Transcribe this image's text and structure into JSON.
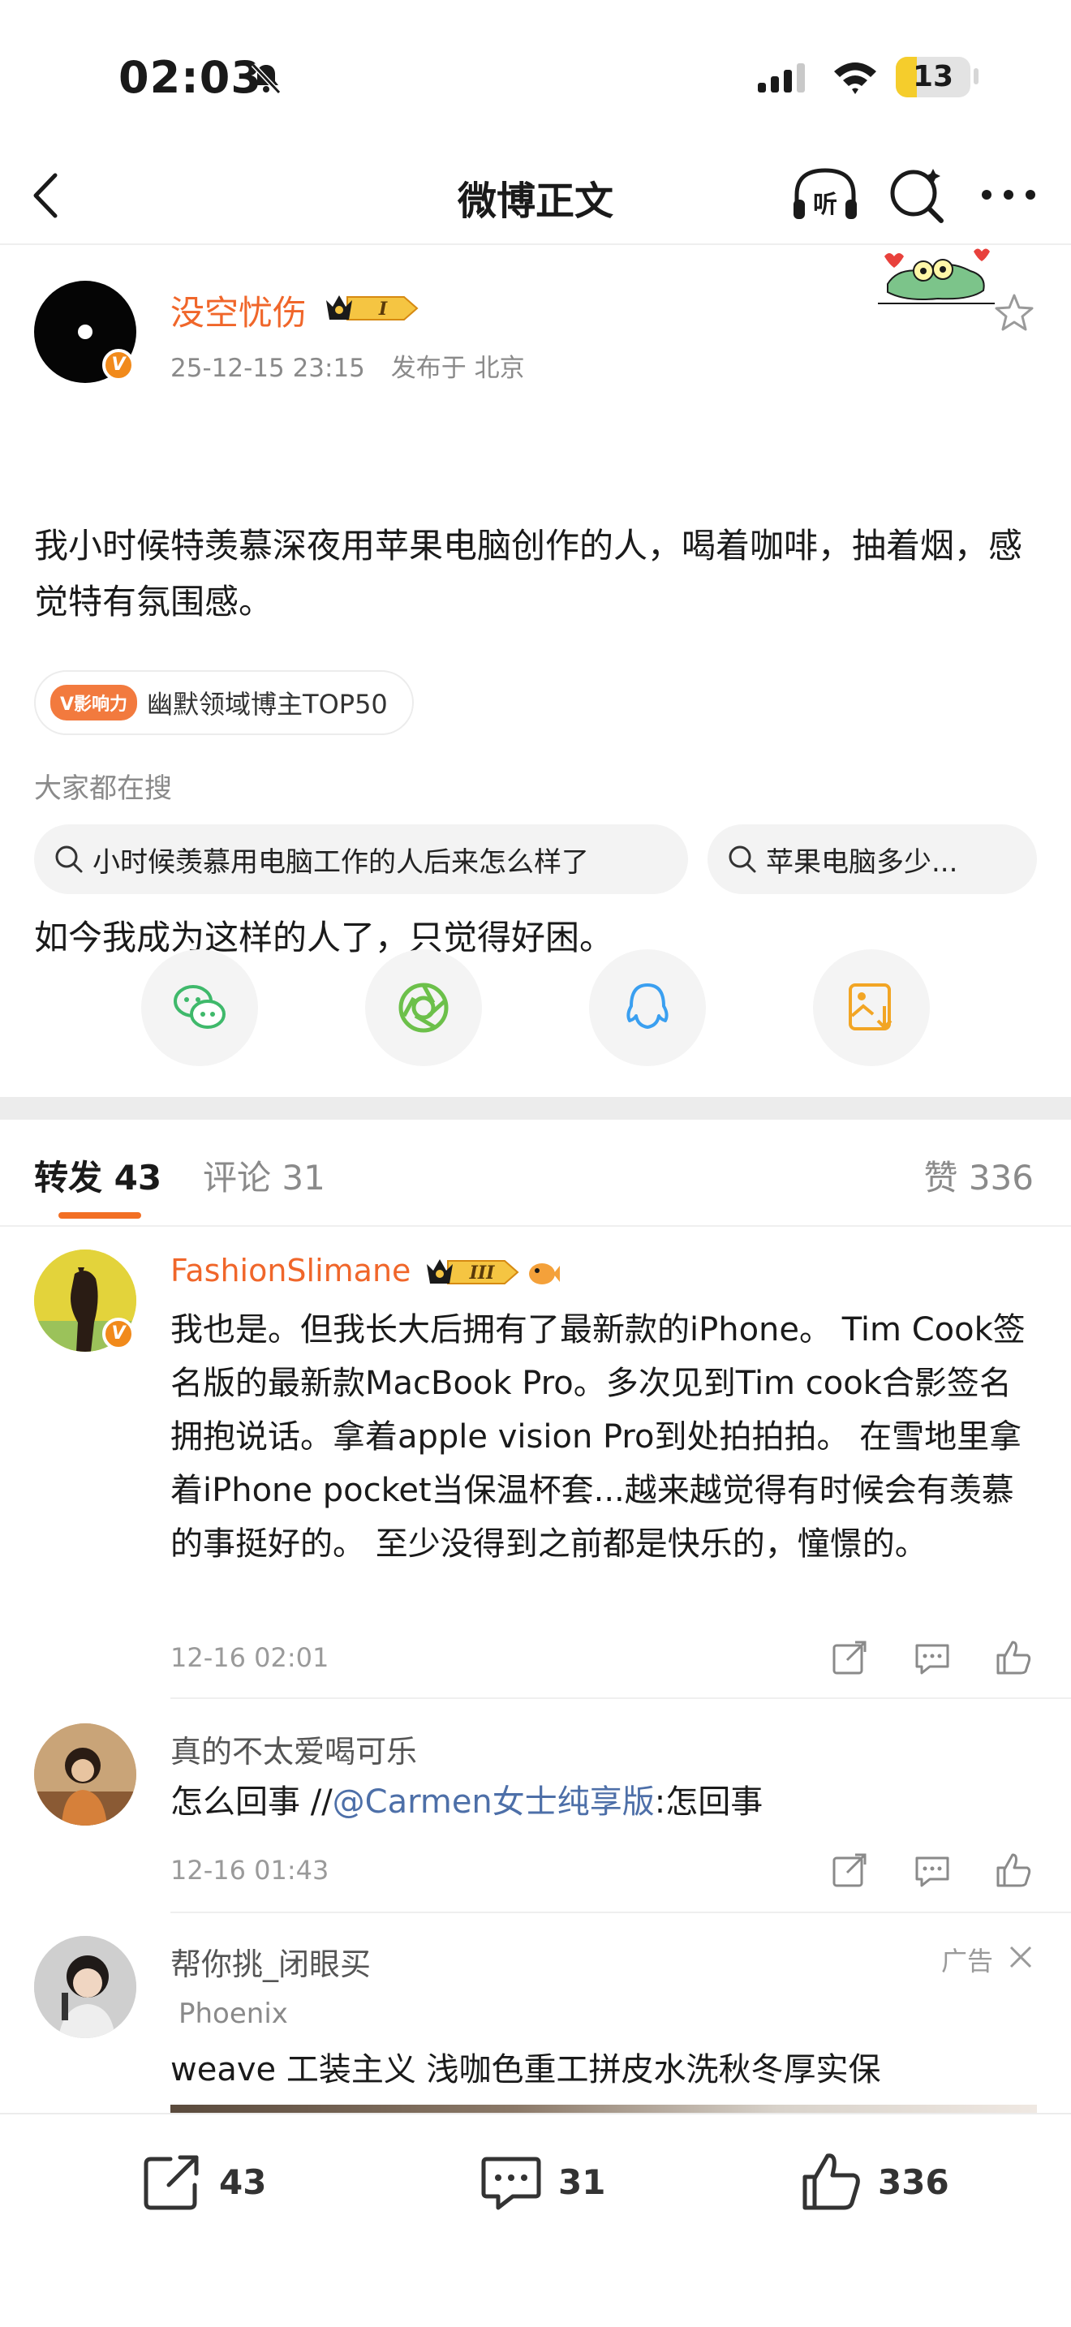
{
  "status_bar": {
    "time": "02:03",
    "battery_level": "13",
    "icons": [
      "bell-off-icon",
      "signal-icon",
      "wifi-icon",
      "battery-icon"
    ]
  },
  "nav": {
    "title": "微博正文",
    "listen_label": "听",
    "icons": [
      "back-arrow-icon",
      "listen-icon",
      "search-icon",
      "more-icon"
    ]
  },
  "post": {
    "username": "没空忧伤",
    "level": "I",
    "date": "25-12-15 23:15",
    "location": "发布于 北京",
    "verified_mark": "V",
    "text_paragraphs": [
      "我小时候特羡慕深夜用苹果电脑创作的人，喝着咖啡，抽着烟，感觉特有氛围感。",
      "如今我成为这样的人了，只觉得好困。"
    ],
    "influence_badge": "V影响力",
    "influence_label": "幽默领域博主TOP50"
  },
  "related_search": {
    "title": "大家都在搜",
    "chips": [
      "小时候羡慕用电脑工作的人后来怎么样了",
      "苹果电脑多少..."
    ]
  },
  "share_targets": [
    "wechat-icon",
    "moments-icon",
    "qq-icon",
    "save-image-icon"
  ],
  "tabs": {
    "repost": "转发 43",
    "comment": "评论 31",
    "likes": "赞 336"
  },
  "comments": [
    {
      "name": "FashionSlimane",
      "level": "III",
      "text": "我也是。但我长大后拥有了最新款的iPhone。 Tim Cook签名版的最新款MacBook Pro。多次见到Tim cook合影签名拥抱说话。拿着apple vision Pro到处拍拍拍。 在雪地里拿着iPhone pocket当保温杯套...越来越觉得有时候会有羡慕的事挺好的。 至少没得到之前都是快乐的，憧憬的。",
      "time": "12-16 02:01"
    },
    {
      "name": "真的不太爱喝可乐",
      "text_prefix": "怎么回事 //",
      "mention": "@Carmen女士纯享版",
      "text_suffix": ":怎回事",
      "time": "12-16 01:43"
    }
  ],
  "ad": {
    "name": "帮你挑_闭眼买",
    "tag": "广告",
    "brand": "Phoenix",
    "text": "weave 工装主义 浅咖色重工拼皮水洗秋冬厚实保"
  },
  "bottom_bar": {
    "repost_count": "43",
    "comment_count": "31",
    "like_count": "336"
  },
  "colors": {
    "accent_orange": "#f0662a",
    "tab_underline": "#f26f24",
    "mention_blue": "#4d6fa8",
    "battery_yellow": "#f5cd2c"
  }
}
